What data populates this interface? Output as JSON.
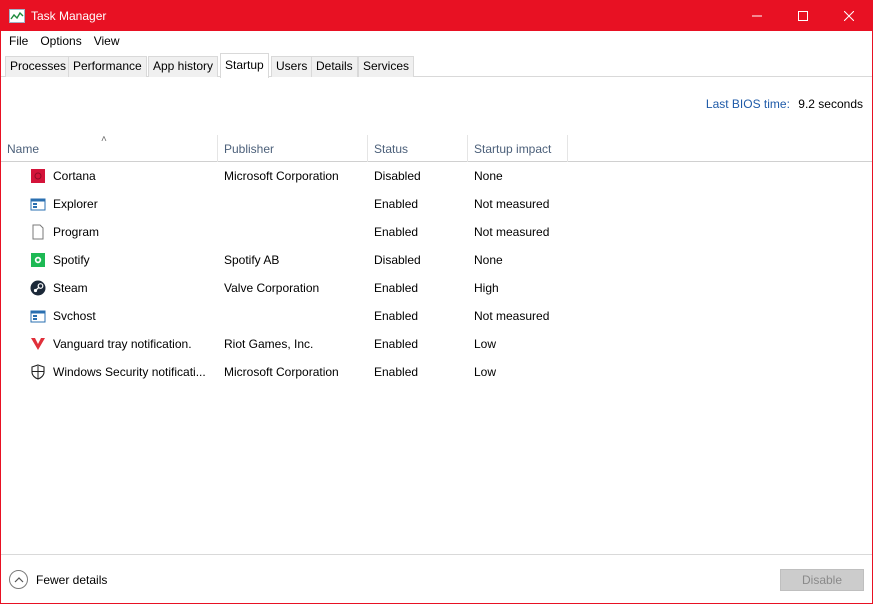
{
  "window": {
    "title": "Task Manager",
    "accent": "#e81123"
  },
  "menu": [
    "File",
    "Options",
    "View"
  ],
  "tabs": [
    {
      "label": "Processes"
    },
    {
      "label": "Performance"
    },
    {
      "label": "App history"
    },
    {
      "label": "Startup",
      "active": true
    },
    {
      "label": "Users"
    },
    {
      "label": "Details"
    },
    {
      "label": "Services"
    }
  ],
  "bios": {
    "label": "Last BIOS time:",
    "value": "9.2 seconds"
  },
  "columns": {
    "name": "Name",
    "publisher": "Publisher",
    "status": "Status",
    "impact": "Startup impact"
  },
  "rows": [
    {
      "icon": "cortana-icon",
      "name": "Cortana",
      "publisher": "Microsoft Corporation",
      "status": "Disabled",
      "impact": "None"
    },
    {
      "icon": "window-app-icon",
      "name": "Explorer",
      "publisher": "",
      "status": "Enabled",
      "impact": "Not measured"
    },
    {
      "icon": "blank-file-icon",
      "name": "Program",
      "publisher": "",
      "status": "Enabled",
      "impact": "Not measured"
    },
    {
      "icon": "spotify-icon",
      "name": "Spotify",
      "publisher": "Spotify AB",
      "status": "Disabled",
      "impact": "None"
    },
    {
      "icon": "steam-icon",
      "name": "Steam",
      "publisher": "Valve Corporation",
      "status": "Enabled",
      "impact": "High"
    },
    {
      "icon": "window-app-icon",
      "name": "Svchost",
      "publisher": "",
      "status": "Enabled",
      "impact": "Not measured"
    },
    {
      "icon": "vanguard-icon",
      "name": "Vanguard tray notification.",
      "publisher": "Riot Games, Inc.",
      "status": "Enabled",
      "impact": "Low"
    },
    {
      "icon": "shield-icon",
      "name": "Windows Security notificati...",
      "publisher": "Microsoft Corporation",
      "status": "Enabled",
      "impact": "Low"
    }
  ],
  "footer": {
    "fewer_details": "Fewer details",
    "disable": "Disable"
  }
}
